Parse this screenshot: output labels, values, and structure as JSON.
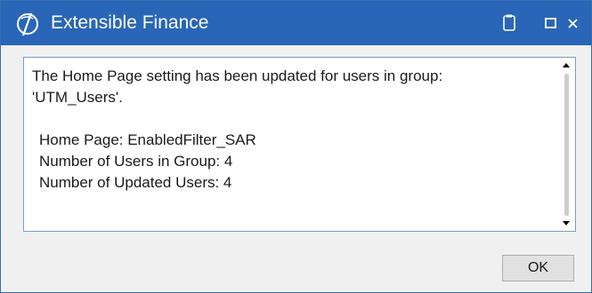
{
  "window": {
    "title": "Extensible Finance",
    "title_bar_color": "#2a66b7",
    "icons": [
      "app-logo-icon",
      "clipboard-icon",
      "maximize-icon",
      "close-icon"
    ]
  },
  "message": {
    "line1": "The Home Page setting has been updated for users in group:",
    "line2": "'UTM_Users'.",
    "home_page": "Home Page: EnabledFilter_SAR",
    "users_in_group": "Number of Users in Group: 4",
    "updated_users": "Number of Updated Users: 4"
  },
  "buttons": {
    "ok_label": "OK"
  }
}
